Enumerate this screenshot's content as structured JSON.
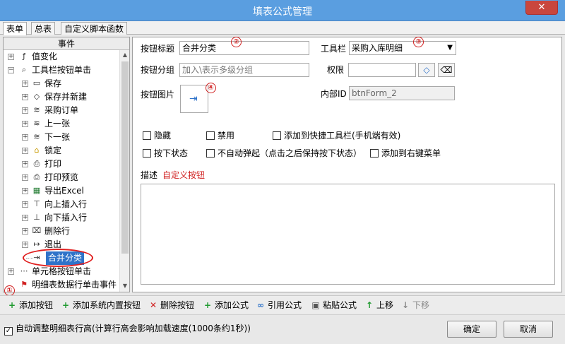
{
  "window": {
    "title": "填表公式管理",
    "close_label": "✕"
  },
  "tabs": [
    "表单",
    "总表",
    "自定义脚本函数"
  ],
  "tree": {
    "header": "事件",
    "items": [
      {
        "label": "值变化",
        "icon": "formula-icon",
        "glyph": "ƒ",
        "level": 0
      },
      {
        "label": "工具栏按钮单击",
        "icon": "search-icon",
        "glyph": "⌕",
        "level": 0
      },
      {
        "label": "保存",
        "icon": "save-icon",
        "glyph": "▭",
        "level": 1
      },
      {
        "label": "保存并新建",
        "icon": "shield-icon",
        "glyph": "◇",
        "level": 1
      },
      {
        "label": "采购订单",
        "icon": "layers-icon",
        "glyph": "≋",
        "level": 1
      },
      {
        "label": "上一张",
        "icon": "layers-icon",
        "glyph": "≋",
        "level": 1
      },
      {
        "label": "下一张",
        "icon": "layers-icon",
        "glyph": "≋",
        "level": 1
      },
      {
        "label": "锁定",
        "icon": "lock-icon",
        "glyph": "🔒",
        "level": 1
      },
      {
        "label": "打印",
        "icon": "print-icon",
        "glyph": "⎙",
        "level": 1
      },
      {
        "label": "打印预览",
        "icon": "print-preview-icon",
        "glyph": "⎙",
        "level": 1
      },
      {
        "label": "导出Excel",
        "icon": "excel-icon",
        "glyph": "▦",
        "level": 1
      },
      {
        "label": "向上插入行",
        "icon": "insert-row-up-icon",
        "glyph": "⊤",
        "level": 1
      },
      {
        "label": "向下插入行",
        "icon": "insert-row-down-icon",
        "glyph": "⊥",
        "level": 1
      },
      {
        "label": "删除行",
        "icon": "delete-row-icon",
        "glyph": "⌧",
        "level": 1
      },
      {
        "label": "退出",
        "icon": "exit-icon",
        "glyph": "↦",
        "level": 1
      },
      {
        "label": "合并分类",
        "icon": "merge-icon",
        "glyph": "⇥",
        "level": 1
      },
      {
        "label": "单元格按钮单击",
        "icon": "cell-icon",
        "glyph": "⋯",
        "level": 0
      },
      {
        "label": "明细表数据行单击事件",
        "icon": "flag-icon",
        "glyph": "⚑",
        "level": 0
      }
    ]
  },
  "form": {
    "title_label": "按钮标题",
    "title_value": "合并分类",
    "toolbar_label": "工具栏",
    "toolbar_value": "采购入库明细",
    "group_label": "按钮分组",
    "group_placeholder": "加入\\表示多级分组",
    "perm_label": "权限",
    "image_label": "按钮图片",
    "internal_id_label": "内部ID",
    "internal_id_value": "btnForm_2",
    "checkboxes": [
      "隐藏",
      "禁用",
      "添加到快捷工具栏(手机端有效)",
      "按下状态",
      "不自动弹起（点击之后保持按下状态）",
      "添加到右键菜单"
    ],
    "desc_label": "描述",
    "desc_value": "自定义按钮"
  },
  "badges": [
    "①",
    "②",
    "③",
    "④"
  ],
  "toolbar": {
    "add_button": "添加按钮",
    "add_system_button": "添加系统内置按钮",
    "delete_button": "删除按钮",
    "add_formula": "添加公式",
    "ref_formula": "引用公式",
    "paste_formula": "粘贴公式",
    "move_up": "上移",
    "move_down": "下移"
  },
  "footer": {
    "auto_adjust": "自动调整明细表行高(计算行高会影响加载速度(1000条约1秒))",
    "ok": "确定",
    "cancel": "取消"
  },
  "colors": {
    "title_bar": "#5a9ee0",
    "selection": "#2f73c9",
    "annotation": "#d02020",
    "description": "#d02020",
    "add_green": "#1f9a2f",
    "delete_red": "#d02020"
  }
}
